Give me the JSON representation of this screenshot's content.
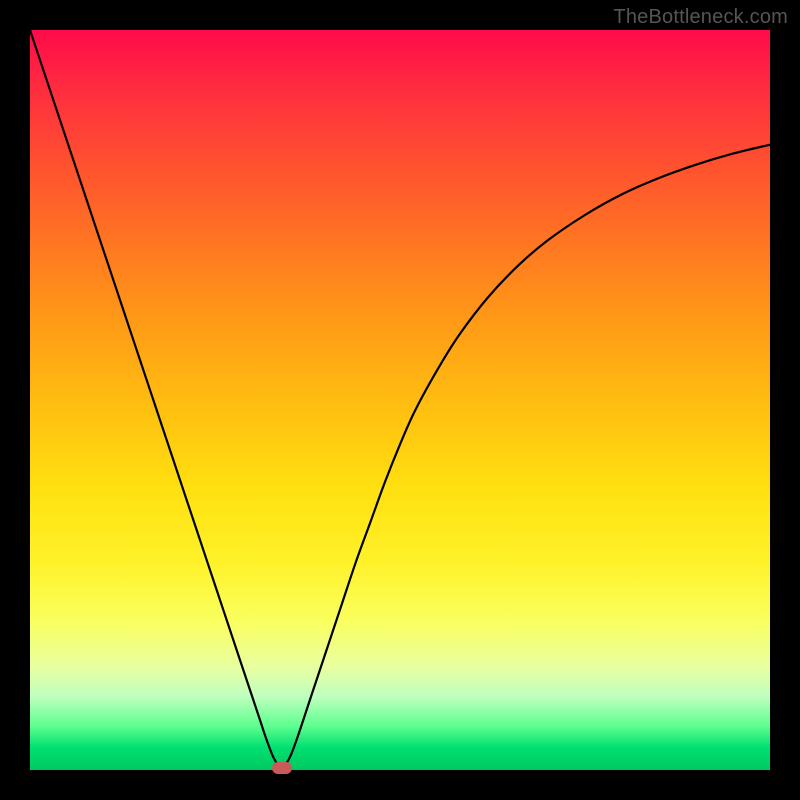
{
  "watermark": "TheBottleneck.com",
  "colors": {
    "frame": "#000000",
    "curve": "#000000",
    "marker": "#c95a5a"
  },
  "chart_data": {
    "type": "line",
    "title": "",
    "xlabel": "",
    "ylabel": "",
    "xlim": [
      0,
      100
    ],
    "ylim": [
      0,
      100
    ],
    "grid": false,
    "legend": false,
    "annotations": [],
    "series": [
      {
        "name": "bottleneck-curve",
        "x": [
          0,
          2,
          4,
          6,
          8,
          10,
          12,
          14,
          16,
          18,
          20,
          22,
          24,
          26,
          28,
          30,
          31,
          32,
          33,
          34,
          35,
          36,
          38,
          40,
          42,
          44,
          46,
          48,
          50,
          52,
          55,
          58,
          62,
          66,
          70,
          75,
          80,
          85,
          90,
          95,
          100
        ],
        "y": [
          100,
          94,
          88,
          82,
          76,
          70,
          64,
          58,
          52,
          46,
          40,
          34,
          28,
          22,
          16,
          10,
          7,
          4,
          1.5,
          0.3,
          1.5,
          4,
          10,
          16,
          22,
          28,
          33.5,
          39,
          44,
          48.5,
          54,
          58.8,
          64,
          68.2,
          71.6,
          75,
          77.8,
          80,
          81.8,
          83.3,
          84.5
        ]
      }
    ],
    "marker": {
      "x": 34,
      "y": 0.3
    }
  }
}
